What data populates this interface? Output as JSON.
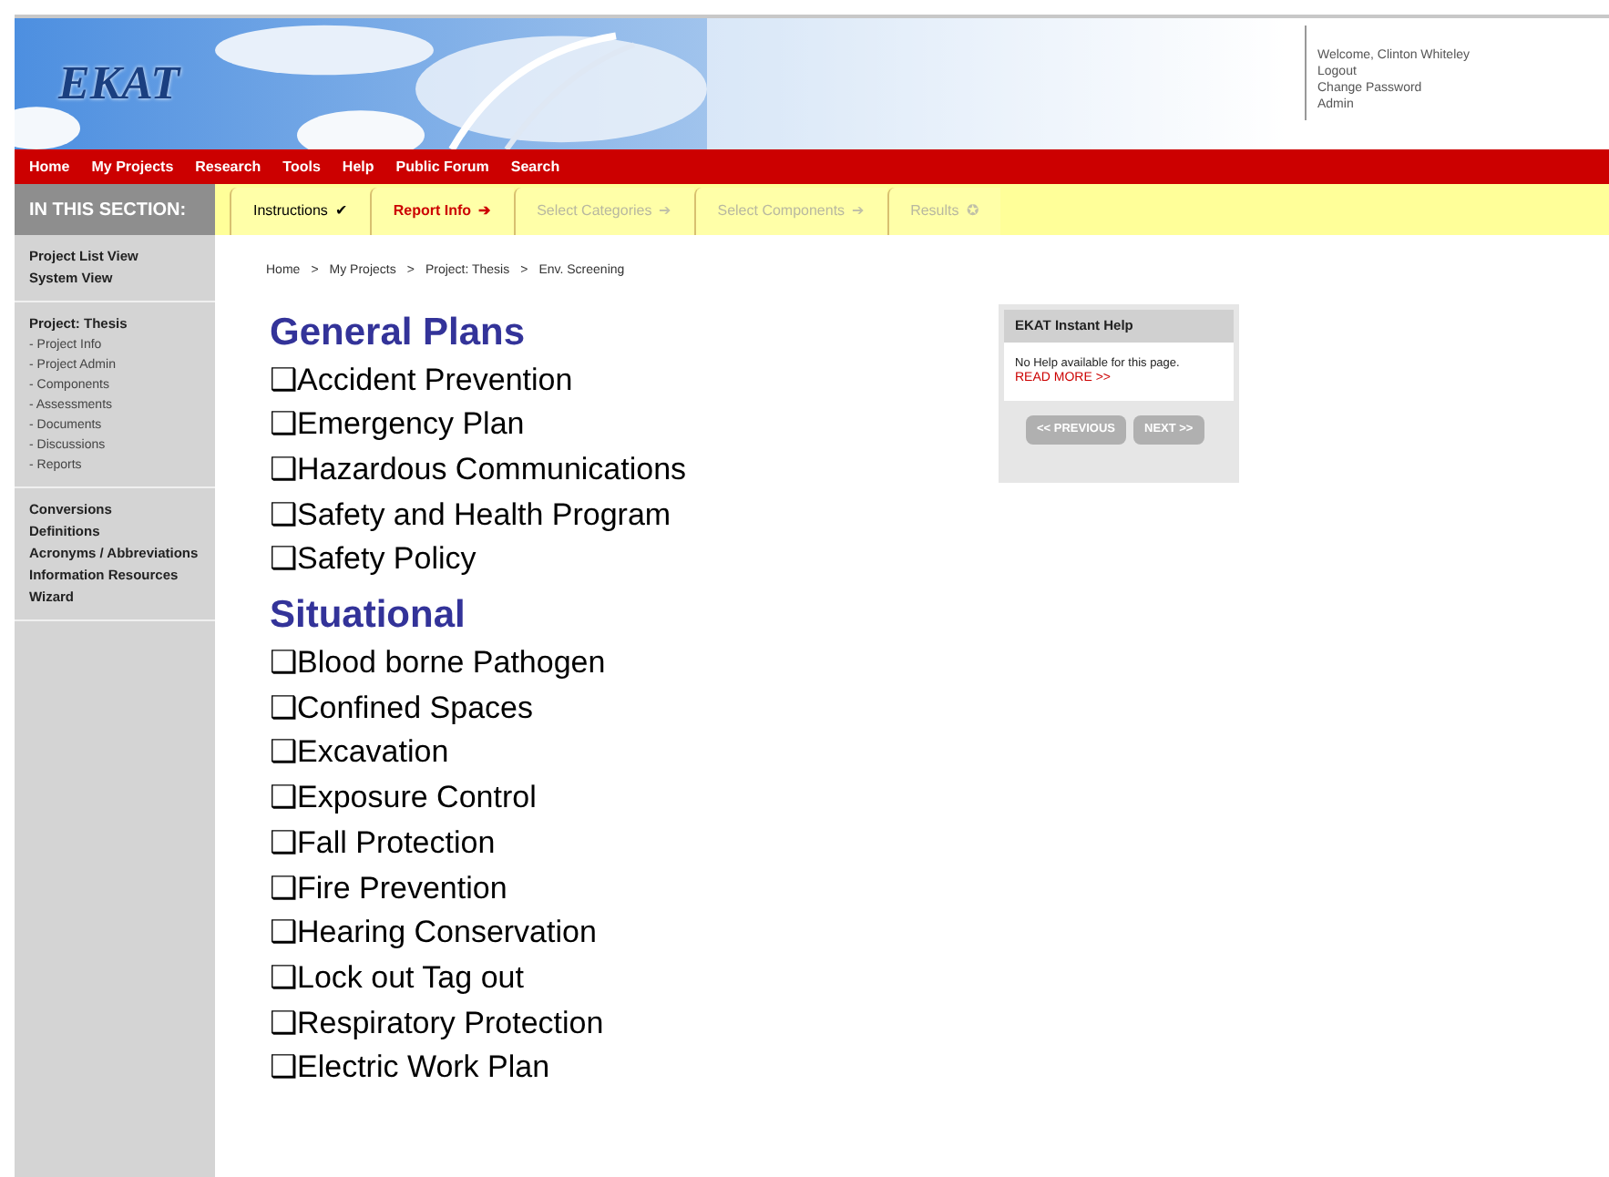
{
  "header": {
    "logo": "EKAT",
    "user_links": [
      "Welcome, Clinton Whiteley",
      "Logout",
      "Change Password",
      "Admin"
    ]
  },
  "nav": [
    "Home",
    "My Projects",
    "Research",
    "Tools",
    "Help",
    "Public Forum",
    "Search"
  ],
  "sidebar": {
    "title": "IN THIS SECTION:",
    "groups": [
      {
        "items": [
          {
            "label": "Project List View",
            "kind": "main"
          },
          {
            "label": "System View",
            "kind": "main"
          }
        ]
      },
      {
        "items": [
          {
            "label": "Project: Thesis",
            "kind": "main"
          },
          {
            "label": "- Project Info",
            "kind": "sub"
          },
          {
            "label": "- Project Admin",
            "kind": "sub"
          },
          {
            "label": "- Components",
            "kind": "sub"
          },
          {
            "label": "- Assessments",
            "kind": "sub"
          },
          {
            "label": "- Documents",
            "kind": "sub"
          },
          {
            "label": "- Discussions",
            "kind": "sub"
          },
          {
            "label": "- Reports",
            "kind": "sub"
          }
        ]
      },
      {
        "items": [
          {
            "label": "Conversions",
            "kind": "main"
          },
          {
            "label": "Definitions",
            "kind": "main"
          },
          {
            "label": "Acronyms / Abbreviations",
            "kind": "main"
          },
          {
            "label": "Information Resources",
            "kind": "main"
          },
          {
            "label": "Wizard",
            "kind": "main"
          }
        ]
      }
    ]
  },
  "steps": [
    {
      "label": "Instructions",
      "icon": "✔",
      "kind": "done"
    },
    {
      "label": "Report Info",
      "icon": "➔",
      "kind": "current"
    },
    {
      "label": "Select Categories",
      "icon": "➔",
      "kind": "disabled"
    },
    {
      "label": "Select Components",
      "icon": "➔",
      "kind": "disabled"
    },
    {
      "label": "Results",
      "icon": "✪",
      "kind": "disabled"
    }
  ],
  "breadcrumb": [
    "Home",
    "My Projects",
    "Project: Thesis",
    "Env. Screening"
  ],
  "breadcrumb_separator": ">",
  "sections": [
    {
      "title": "General Plans",
      "items": [
        "❑Accident Prevention",
        "❑Emergency Plan",
        "❑Hazardous Communications",
        "❑Safety and Health Program",
        "❑Safety Policy"
      ]
    },
    {
      "title": "Situational",
      "items": [
        "❑Blood borne Pathogen",
        "❑Confined Spaces",
        "❑Excavation",
        "❑Exposure Control",
        "❑Fall Protection",
        "❑Fire Prevention",
        "❑Hearing Conservation",
        "❑Lock out Tag out",
        "❑Respiratory Protection",
        "❑Electric Work Plan"
      ]
    }
  ],
  "help": {
    "title": "EKAT Instant Help",
    "text": "No Help available for this page.",
    "link": "READ MORE >>",
    "buttons": [
      "<< PREVIOUS",
      "NEXT >>"
    ]
  }
}
